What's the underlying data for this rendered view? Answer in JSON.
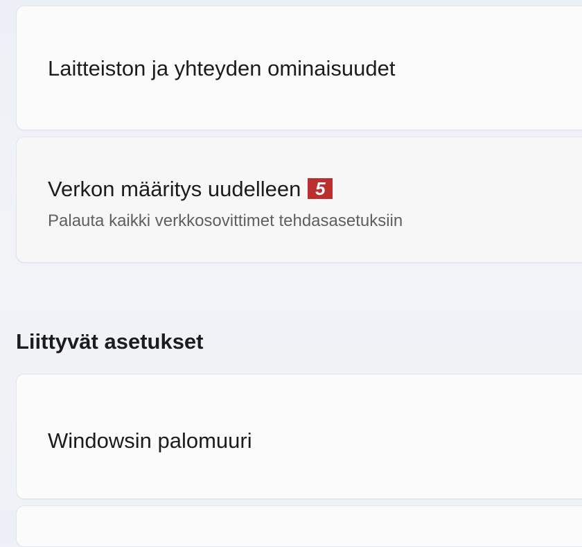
{
  "network_section": {
    "items": [
      {
        "title": "Laitteiston ja yhteyden ominaisuudet"
      },
      {
        "title": "Verkon määritys uudelleen",
        "badge": "5",
        "subtitle": "Palauta kaikki verkkosovittimet tehdasasetuksiin"
      }
    ]
  },
  "related_settings": {
    "heading": "Liittyvät asetukset",
    "items": [
      {
        "title": "Windowsin palomuuri"
      }
    ]
  },
  "colors": {
    "badge_background": "#bc2f2f",
    "card_background": "#fbfbfc",
    "page_background": "#eef1f5"
  }
}
